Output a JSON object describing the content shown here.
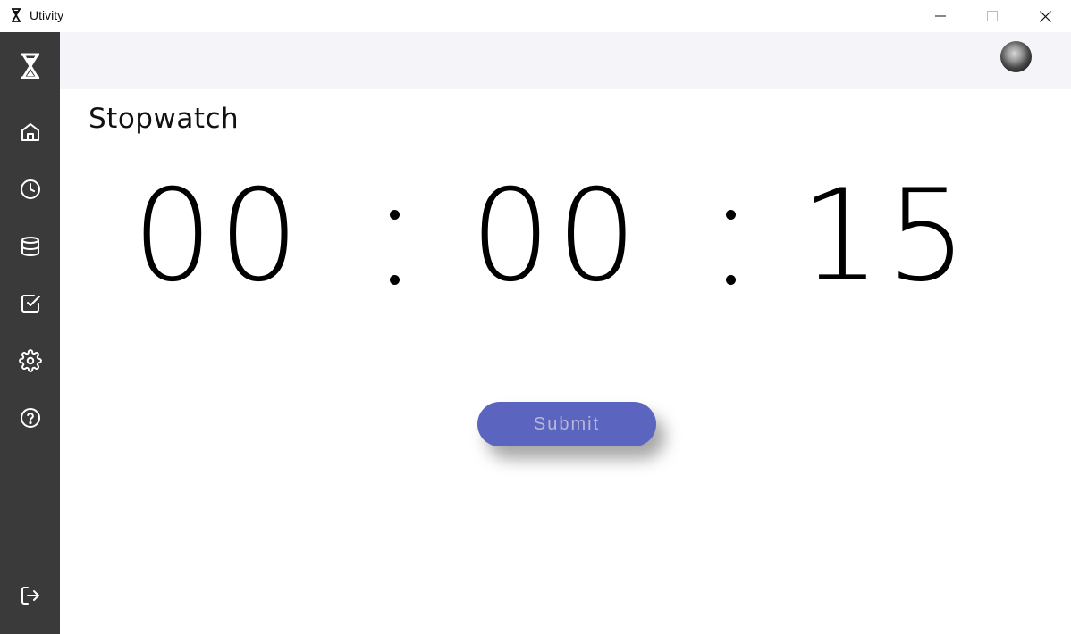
{
  "window": {
    "title": "Utivity"
  },
  "sidebar": {
    "items": [
      {
        "icon": "hourglass-logo-icon"
      },
      {
        "icon": "home-icon"
      },
      {
        "icon": "clock-icon"
      },
      {
        "icon": "database-icon"
      },
      {
        "icon": "checkbox-icon"
      },
      {
        "icon": "gear-icon"
      },
      {
        "icon": "help-icon"
      },
      {
        "icon": "logout-icon"
      }
    ],
    "background": "#3a3a3a"
  },
  "header": {
    "avatar_icon": "user-avatar"
  },
  "main": {
    "title": "Stopwatch",
    "stopwatch": {
      "hours": "00",
      "minutes": "00",
      "seconds": "15"
    },
    "submit_label": "Submit"
  },
  "colors": {
    "accent": "#5b65bf",
    "header_bg": "#f5f5f9"
  }
}
